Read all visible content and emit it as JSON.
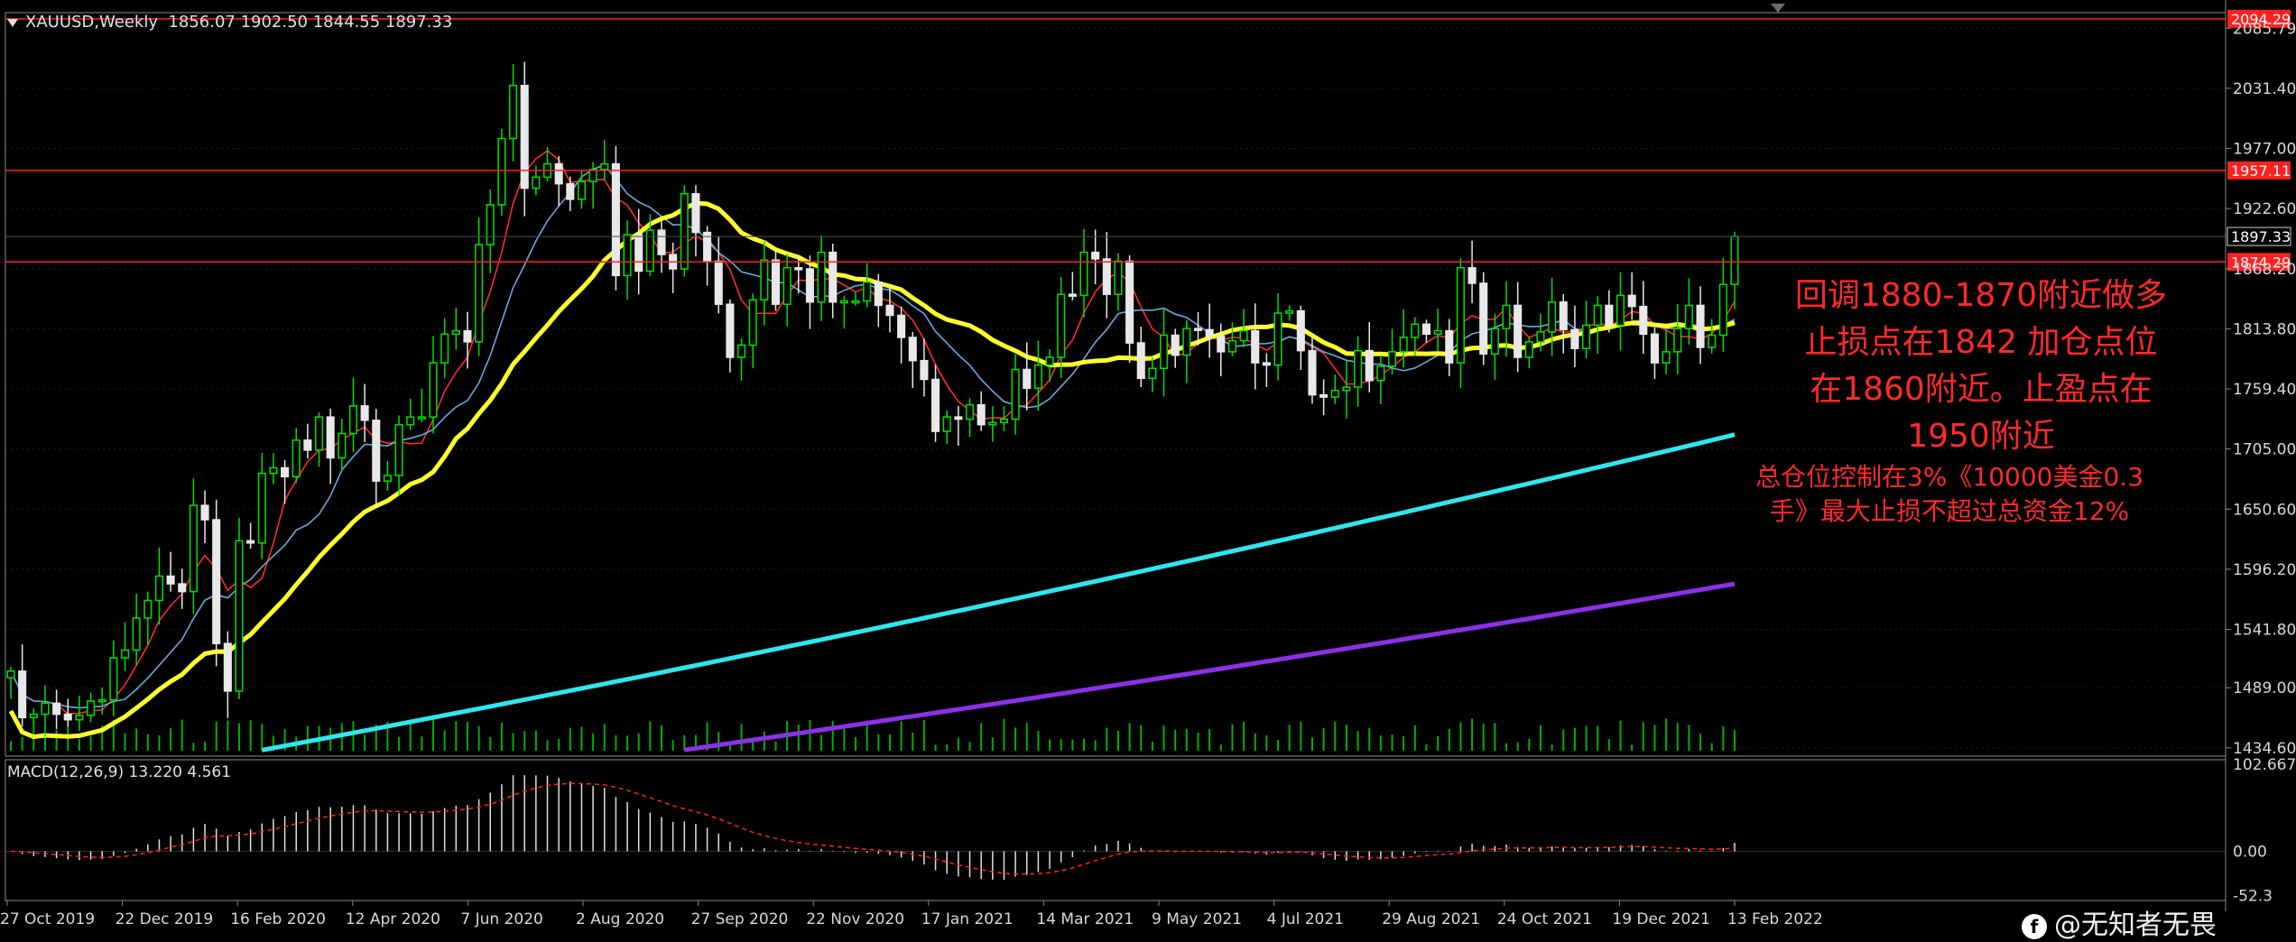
{
  "header": {
    "symbol_text": "XAUUSD,Weekly  1856.07 1902.50 1844.55 1897.33"
  },
  "macd": {
    "label": "MACD(12,26,9) 13.220 4.561"
  },
  "notes": {
    "line1": "回调1880-1870附近做多",
    "line2": "止损点在1842 加仓点位",
    "line3": "在1860附近。止盈点在",
    "line4": "1950附近",
    "line5": "总仓位控制在3%《10000美金0.3",
    "line6": "手》最大止损不超过总资金12%"
  },
  "watermark": {
    "text": "@无知者无畏"
  },
  "colors": {
    "bull": "#00e000",
    "bear": "#e8e8e8",
    "ma_yellow": "#ffff2a",
    "ma_cyan": "#2fe6ee",
    "ma_purple": "#8c30e8",
    "ma_red": "#ff2a2a",
    "ma_blue": "#6aa8e0",
    "level_line": "#ff2020",
    "macd_hist": "#e0e0e0",
    "macd_signal": "#ff2020",
    "grid": "#1e1e1e"
  },
  "chart_data": {
    "type": "candlestick",
    "symbol": "XAUUSD",
    "timeframe": "Weekly",
    "y_ticks": [
      "2085.79",
      "2031.40",
      "1977.00",
      "1922.60",
      "1868.20",
      "1813.80",
      "1759.40",
      "1705.00",
      "1650.60",
      "1596.20",
      "1541.80",
      "1489.00",
      "1434.60"
    ],
    "y_range": [
      1432,
      2095
    ],
    "price_tags": [
      {
        "label": "2094.29",
        "value": 2094.29,
        "type": "level"
      },
      {
        "label": "1957.11",
        "value": 1957.11,
        "type": "level"
      },
      {
        "label": "1897.33",
        "value": 1897.33,
        "type": "current"
      },
      {
        "label": "1874.29",
        "value": 1874.29,
        "type": "level"
      }
    ],
    "x_labels": [
      "27 Oct 2019",
      "22 Dec 2019",
      "16 Feb 2020",
      "12 Apr 2020",
      "7 Jun 2020",
      "2 Aug 2020",
      "27 Sep 2020",
      "22 Nov 2020",
      "17 Jan 2021",
      "14 Mar 2021",
      "9 May 2021",
      "4 Jul 2021",
      "29 Aug 2021",
      "24 Oct 2021",
      "19 Dec 2021",
      "13 Feb 2022"
    ],
    "macd_ticks": [
      "102.667",
      "0.00",
      "-52.3"
    ],
    "macd_range": [
      -58,
      108
    ],
    "closes": [
      1504,
      1462,
      1465,
      1475,
      1465,
      1460,
      1464,
      1477,
      1478,
      1516,
      1523,
      1552,
      1568,
      1590,
      1583,
      1576,
      1654,
      1641,
      1529,
      1486,
      1622,
      1620,
      1683,
      1688,
      1680,
      1713,
      1704,
      1734,
      1697,
      1719,
      1744,
      1731,
      1676,
      1681,
      1727,
      1734,
      1734,
      1783,
      1809,
      1812,
      1802,
      1890,
      1926,
      1986,
      2034,
      1941,
      1951,
      1963,
      1945,
      1931,
      1947,
      1958,
      1963,
      1862,
      1899,
      1866,
      1903,
      1881,
      1868,
      1936,
      1901,
      1875,
      1836,
      1788,
      1799,
      1840,
      1876,
      1836,
      1869,
      1868,
      1838,
      1883,
      1838,
      1839,
      1839,
      1856,
      1835,
      1826,
      1806,
      1785,
      1768,
      1721,
      1734,
      1732,
      1745,
      1727,
      1729,
      1732,
      1777,
      1760,
      1781,
      1788,
      1845,
      1844,
      1883,
      1877,
      1845,
      1875,
      1801,
      1769,
      1778,
      1808,
      1790,
      1814,
      1813,
      1807,
      1793,
      1803,
      1812,
      1783,
      1781,
      1828,
      1830,
      1794,
      1754,
      1752,
      1758,
      1761,
      1794,
      1767,
      1780,
      1793,
      1806,
      1818,
      1809,
      1812,
      1783,
      1869,
      1855,
      1791,
      1814,
      1835,
      1788,
      1802,
      1811,
      1838,
      1813,
      1796,
      1817,
      1835,
      1817,
      1844,
      1834,
      1809,
      1783,
      1793,
      1814,
      1835,
      1797,
      1808,
      1854,
      1897.33
    ],
    "series": [
      {
        "name": "",
        "color_key": "ma_yellow",
        "start": 1508,
        "end": 1804
      },
      {
        "name": "",
        "color_key": "ma_cyan",
        "start": 1391,
        "end": 1718
      },
      {
        "name": "",
        "color_key": "ma_purple",
        "start": 1350,
        "end": 1583
      }
    ],
    "grid": true
  }
}
